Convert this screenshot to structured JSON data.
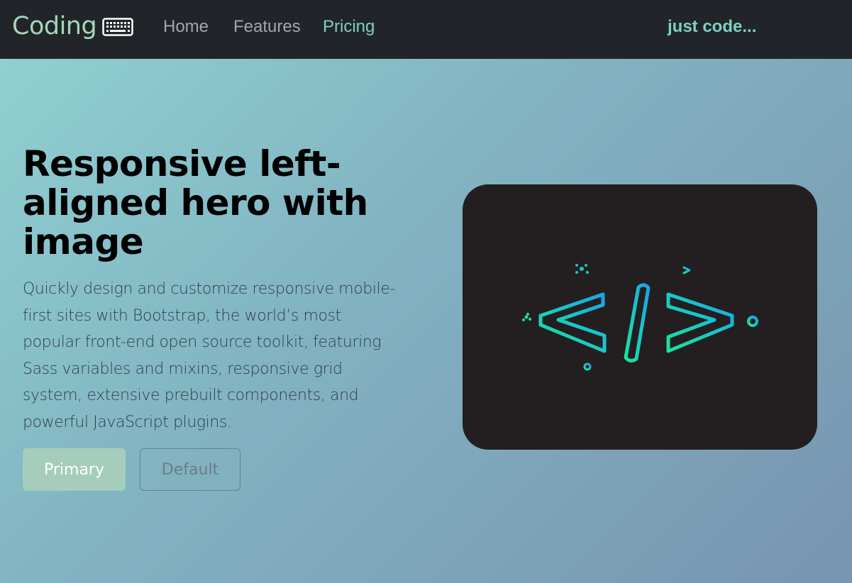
{
  "navbar": {
    "brand": "Coding",
    "brand_icon": "keyboard-icon",
    "links": [
      {
        "label": "Home",
        "active": false
      },
      {
        "label": "Features",
        "active": false
      },
      {
        "label": "Pricing",
        "active": true
      }
    ],
    "tagline": "just code..."
  },
  "hero": {
    "title": "Responsive left-aligned hero with image",
    "text": "Quickly design and customize responsive mobile-first sites with Bootstrap, the world’s most popular front-end open source toolkit, featuring Sass variables and mixins, responsive grid system, extensive prebuilt components, and powerful JavaScript plugins.",
    "primary_button": "Primary",
    "default_button": "Default",
    "image_icon": "code-tag-icon"
  },
  "colors": {
    "navbar_bg": "#212529",
    "brand": "#a5d6b8",
    "accent": "#7ecfc4",
    "primary_button": "#a6cdbb",
    "image_bg": "#231f20"
  }
}
